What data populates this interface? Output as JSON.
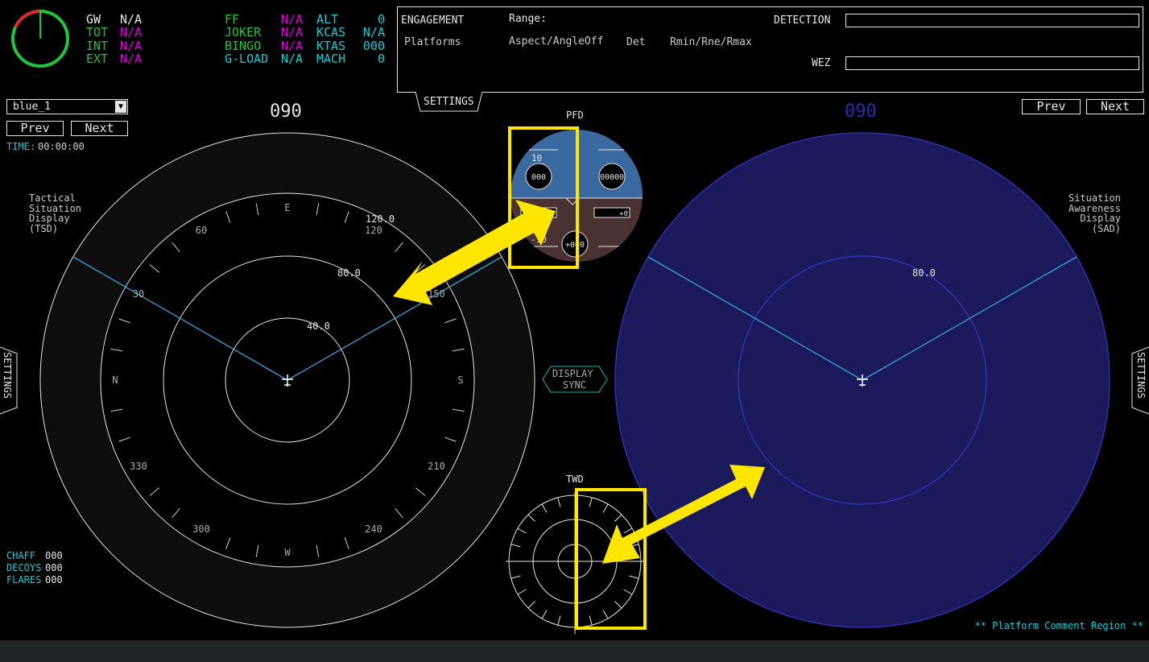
{
  "fuel": {
    "gw_label": "GW",
    "gw_value": "N/A",
    "tot_label": "TOT",
    "tot_value": "N/A",
    "int_label": "INT",
    "int_value": "N/A",
    "ext_label": "EXT",
    "ext_value": "N/A"
  },
  "flight": {
    "ff_label": "FF",
    "ff_value": "N/A",
    "joker_label": "JOKER",
    "joker_value": "N/A",
    "bingo_label": "BINGO",
    "bingo_value": "N/A",
    "gload_label": "G-LOAD",
    "gload_value": "N/A",
    "alt_label": "ALT",
    "alt_value": "0",
    "kcas_label": "KCAS",
    "kcas_value": "N/A",
    "ktas_label": "KTAS",
    "ktas_value": "000",
    "mach_label": "MACH",
    "mach_value": "0"
  },
  "engagement": {
    "title": "ENGAGEMENT",
    "range_label": "Range:",
    "platforms_label": "Platforms",
    "aspect_label": "Aspect/AngleOff",
    "det_label": "Det",
    "rmin_label": "Rmin/Rne/Rmax",
    "detection_label": "DETECTION",
    "wez_label": "WEZ",
    "settings_tab": "SETTINGS"
  },
  "left_panel": {
    "platform_select": "blue_1",
    "prev_label": "Prev",
    "next_label": "Next",
    "time_label": "TIME:",
    "time_value": "00:00:00",
    "heading": "090",
    "display_title": "Tactical\nSituation\nDisplay\n(TSD)",
    "settings_tab": "SETTINGS"
  },
  "right_panel": {
    "prev_label": "Prev",
    "next_label": "Next",
    "heading": "090",
    "display_title": "Situation\nAwareness\nDisplay\n(SAD)",
    "settings_tab": "SETTINGS"
  },
  "tsd": {
    "range_labels": [
      "120.0",
      "80.0",
      "40.0"
    ],
    "compass_labels": [
      "E",
      "120",
      "150",
      "S",
      "210",
      "240",
      "W",
      "300",
      "330",
      "N",
      "30",
      "60"
    ]
  },
  "sad": {
    "range_label": "80.0"
  },
  "pfd": {
    "title": "PFD",
    "pitch_top": "10",
    "pitch_bottom": "-10",
    "speed_value": "000",
    "alt_value": "00000",
    "left_box_value": "",
    "right_box_value": "+0",
    "bottom_value": "+000"
  },
  "twd": {
    "title": "TWD"
  },
  "display_sync": {
    "line1": "DISPLAY",
    "line2": "SYNC"
  },
  "countermeasures": {
    "chaff_label": "CHAFF",
    "chaff_value": "000",
    "decoys_label": "DECOYS",
    "decoys_value": "000",
    "flares_label": "FLARES",
    "flares_value": "000"
  },
  "comment_region": "** Platform Comment Region **",
  "colors": {
    "fuel_green": "#21c43a",
    "value_magenta": "#d400d4",
    "cyan": "#22c8d0",
    "sad_blue": "#1a1a5a",
    "highlight_yellow": "#ffe600",
    "red_arc": "#e0282b"
  }
}
